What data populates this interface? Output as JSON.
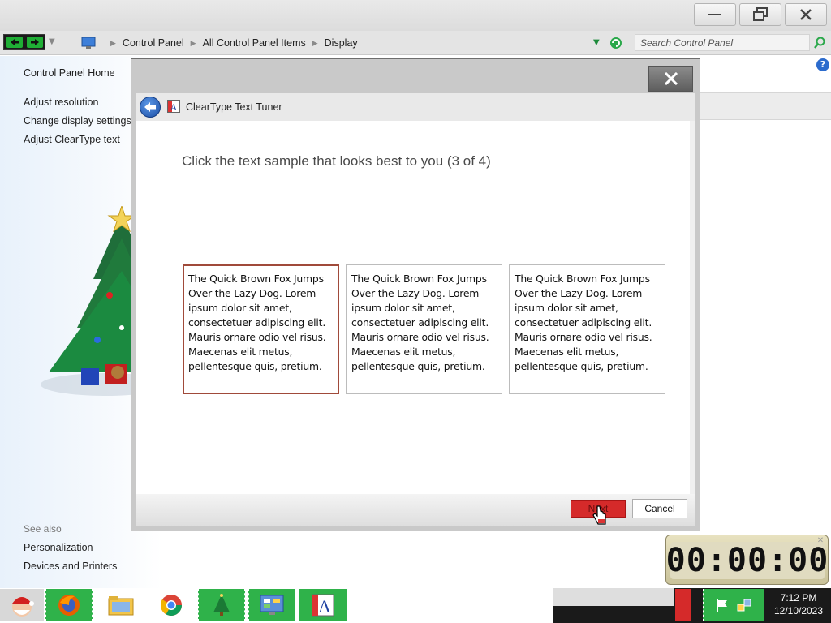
{
  "window": {
    "minimize_label": "minimize",
    "maximize_label": "restore",
    "close_label": "close"
  },
  "address": {
    "breadcrumbs": [
      "Control Panel",
      "All Control Panel Items",
      "Display"
    ],
    "search_placeholder": "Search Control Panel"
  },
  "sidebar": {
    "home": "Control Panel Home",
    "links": [
      "Adjust resolution",
      "Change display settings",
      "Adjust ClearType text"
    ],
    "see_also_heading": "See also",
    "see_also_links": [
      "Personalization",
      "Devices and Printers"
    ]
  },
  "dialog": {
    "title": "ClearType Text Tuner",
    "instruction": "Click the text sample that looks best to you (3 of 4)",
    "samples": [
      {
        "text": "The Quick Brown Fox Jumps Over the Lazy Dog. Lorem ipsum dolor sit amet, consectetuer adipiscing elit. Mauris ornare odio vel risus. Maecenas elit metus, pellentesque quis, pretium.",
        "selected": true
      },
      {
        "text": "The Quick Brown Fox Jumps Over the Lazy Dog. Lorem ipsum dolor sit amet, consectetuer adipiscing elit. Mauris ornare odio vel risus. Maecenas elit metus, pellentesque quis, pretium.",
        "selected": false
      },
      {
        "text": "The Quick Brown Fox Jumps Over the Lazy Dog. Lorem ipsum dolor sit amet, consectetuer adipiscing elit. Mauris ornare odio vel risus. Maecenas elit metus, pellentesque quis, pretium.",
        "selected": false
      }
    ],
    "next_button": "Next",
    "cancel_button": "Cancel"
  },
  "gadget": {
    "time": "00:00:00"
  },
  "taskbar": {
    "items": [
      "start",
      "firefox",
      "file-explorer",
      "chrome",
      "christmas-tree",
      "control-panel",
      "cleartype-tuner"
    ],
    "clock_time": "7:12 PM",
    "clock_date": "12/10/2023"
  },
  "colors": {
    "selected_border": "#a04a3a",
    "next_button": "#d52a2a",
    "taskbar_green": "#2fb24a"
  }
}
